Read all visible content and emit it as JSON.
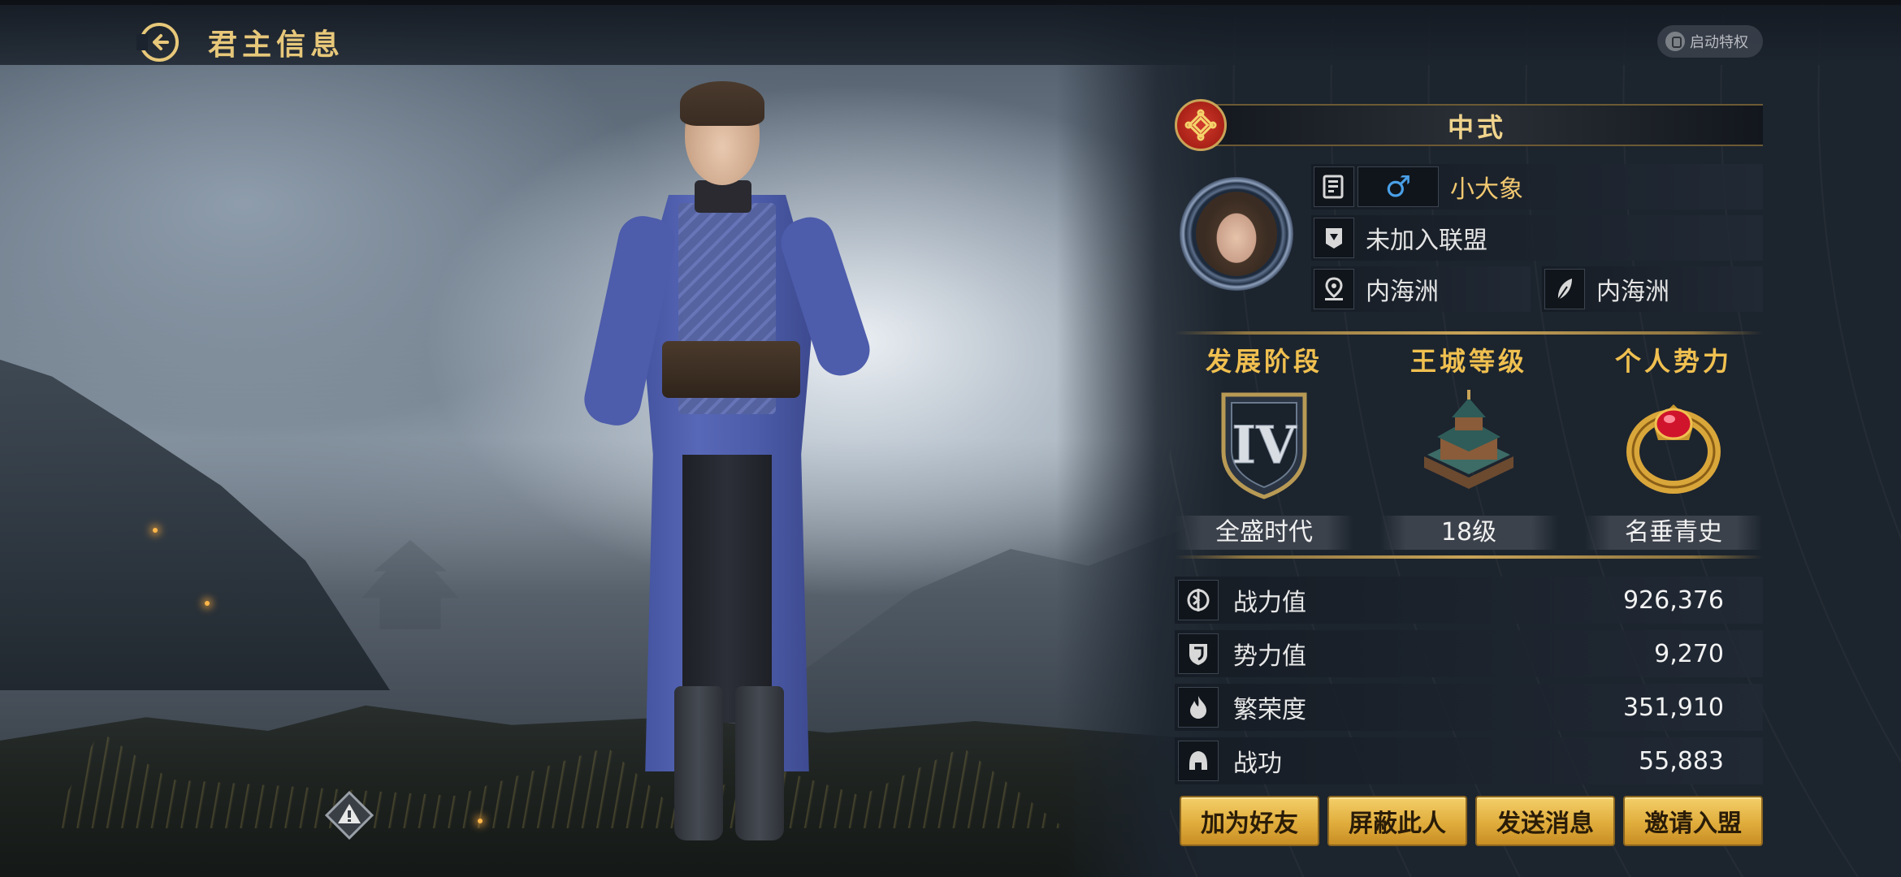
{
  "topbar": {
    "title": "君主信息",
    "privilege_label": "启动特权"
  },
  "profile": {
    "style_name": "中式",
    "player_name": "小大象",
    "gender_symbol": "♂",
    "alliance": "未加入联盟",
    "region": "内海洲",
    "origin": "内海洲"
  },
  "stats": {
    "stage_label": "发展阶段",
    "stage_value": "全盛时代",
    "city_label": "王城等级",
    "city_value": "18级",
    "power_label": "个人势力",
    "power_value": "名垂青史"
  },
  "metrics": [
    {
      "name": "战力值",
      "value": "926,376",
      "icon": "combat-power-icon"
    },
    {
      "name": "势力值",
      "value": "9,270",
      "icon": "shield-icon"
    },
    {
      "name": "繁荣度",
      "value": "351,910",
      "icon": "flame-icon"
    },
    {
      "name": "战功",
      "value": "55,883",
      "icon": "helmet-icon"
    }
  ],
  "actions": {
    "add_friend": "加为好友",
    "block": "屏蔽此人",
    "message": "发送消息",
    "invite": "邀请入盟"
  },
  "colors": {
    "accent_gold": "#e7c87a",
    "button_gold": "#e0ad3c",
    "panel_bg": "#1c242e",
    "name_color": "#f2c870",
    "gender_blue": "#4aa0e8"
  }
}
